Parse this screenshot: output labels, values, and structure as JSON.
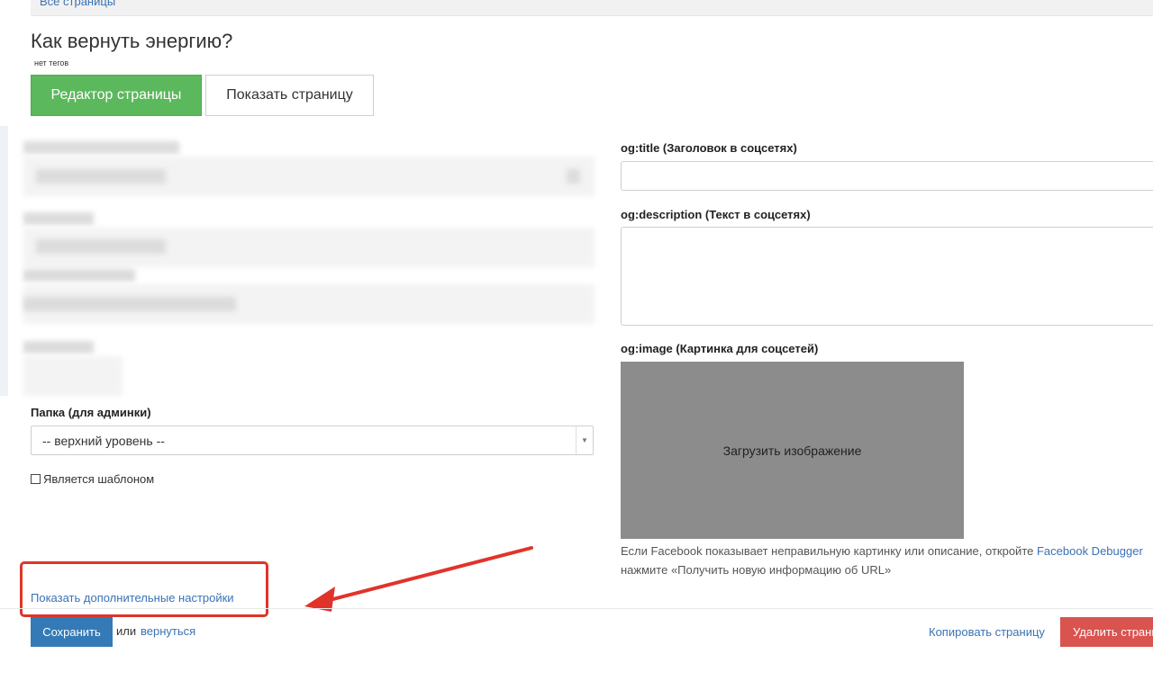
{
  "topbar": {
    "breadcrumb": "Все страницы"
  },
  "page": {
    "title": "Как вернуть энергию?",
    "tags": "нет тегов"
  },
  "tabs": {
    "editor": "Редактор страницы",
    "show": "Показать страницу"
  },
  "form": {
    "folder_label": "Папка (для админки)",
    "folder_value": "-- верхний уровень --",
    "template_label": "Является шаблоном",
    "og_title_label": "og:title (Заголовок в соцсетях)",
    "og_desc_label": "og:description (Текст в соцсетях)",
    "og_image_label": "og:image (Картинка для соцсетей)",
    "upload_label": "Загрузить изображение",
    "fb_note_1": "Если Facebook показывает неправильную картинку или описание, откройте ",
    "fb_link": "Facebook Debugger",
    "fb_note_2": "нажмите «Получить новую информацию об URL»"
  },
  "footer": {
    "advanced_link": "Показать дополнительные настройки",
    "save": "Сохранить",
    "or": "или",
    "back": "вернуться",
    "copy": "Копировать страницу",
    "delete": "Удалить страницу"
  },
  "colors": {
    "accent_green": "#5cb85c",
    "primary_blue": "#337ab7",
    "danger_red": "#d9534f",
    "annotation_red": "#e0342b"
  }
}
